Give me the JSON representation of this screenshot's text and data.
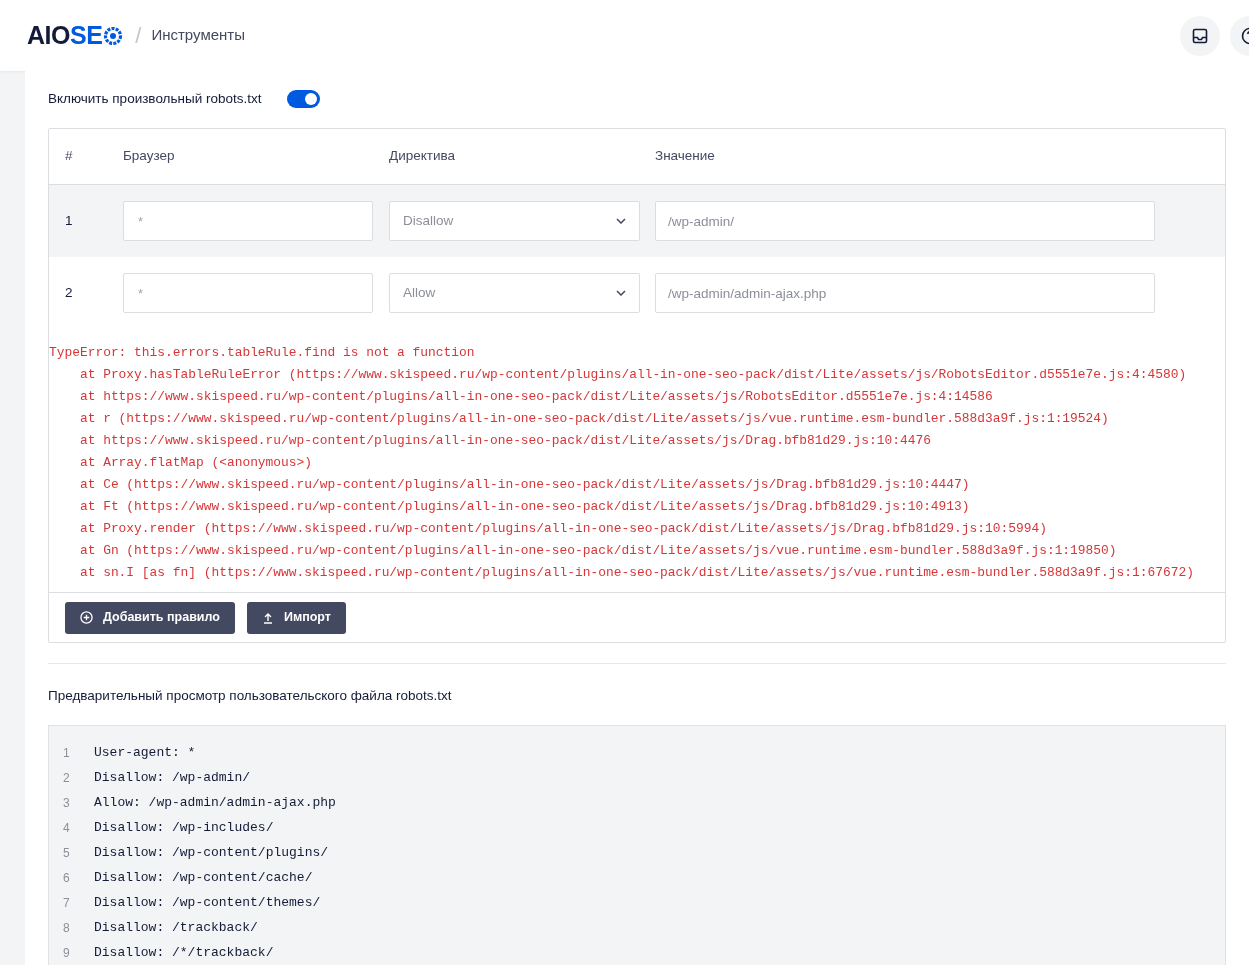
{
  "header": {
    "logo": {
      "dark": "AIO",
      "accent": "SE"
    },
    "separator": "/",
    "breadcrumb": "Инструменты"
  },
  "toggle": {
    "label": "Включить произвольный robots.txt",
    "on": true
  },
  "table": {
    "columns": [
      "#",
      "Браузер",
      "Директива",
      "Значение"
    ],
    "rows": [
      {
        "number": "1",
        "browser": "*",
        "directive": "Disallow",
        "value": "/wp-admin/",
        "highlighted": true
      },
      {
        "number": "2",
        "browser": "*",
        "directive": "Allow",
        "value": "/wp-admin/admin-ajax.php",
        "highlighted": false
      }
    ]
  },
  "error": [
    "TypeError: this.errors.tableRule.find is not a function",
    "    at Proxy.hasTableRuleError (https://www.skispeed.ru/wp-content/plugins/all-in-one-seo-pack/dist/Lite/assets/js/RobotsEditor.d5551e7e.js:4:4580)",
    "    at https://www.skispeed.ru/wp-content/plugins/all-in-one-seo-pack/dist/Lite/assets/js/RobotsEditor.d5551e7e.js:4:14586",
    "    at r (https://www.skispeed.ru/wp-content/plugins/all-in-one-seo-pack/dist/Lite/assets/js/vue.runtime.esm-bundler.588d3a9f.js:1:19524)",
    "    at https://www.skispeed.ru/wp-content/plugins/all-in-one-seo-pack/dist/Lite/assets/js/Drag.bfb81d29.js:10:4476",
    "    at Array.flatMap (<anonymous>)",
    "    at Ce (https://www.skispeed.ru/wp-content/plugins/all-in-one-seo-pack/dist/Lite/assets/js/Drag.bfb81d29.js:10:4447)",
    "    at Ft (https://www.skispeed.ru/wp-content/plugins/all-in-one-seo-pack/dist/Lite/assets/js/Drag.bfb81d29.js:10:4913)",
    "    at Proxy.render (https://www.skispeed.ru/wp-content/plugins/all-in-one-seo-pack/dist/Lite/assets/js/Drag.bfb81d29.js:10:5994)",
    "    at Gn (https://www.skispeed.ru/wp-content/plugins/all-in-one-seo-pack/dist/Lite/assets/js/vue.runtime.esm-bundler.588d3a9f.js:1:19850)",
    "    at sn.I [as fn] (https://www.skispeed.ru/wp-content/plugins/all-in-one-seo-pack/dist/Lite/assets/js/vue.runtime.esm-bundler.588d3a9f.js:1:67672)"
  ],
  "buttons": [
    {
      "kind": "add",
      "label": "Добавить правило"
    },
    {
      "kind": "import",
      "label": "Импорт"
    }
  ],
  "preview": {
    "title": "Предварительный просмотр пользовательского файла robots.txt",
    "lines": [
      {
        "number": "1",
        "text": "User-agent: *"
      },
      {
        "number": "2",
        "text": "Disallow: /wp-admin/"
      },
      {
        "number": "3",
        "text": "Allow: /wp-admin/admin-ajax.php"
      },
      {
        "number": "4",
        "text": "Disallow: /wp-includes/"
      },
      {
        "number": "5",
        "text": "Disallow: /wp-content/plugins/"
      },
      {
        "number": "6",
        "text": "Disallow: /wp-content/cache/"
      },
      {
        "number": "7",
        "text": "Disallow: /wp-content/themes/"
      },
      {
        "number": "8",
        "text": "Disallow: /trackback/"
      },
      {
        "number": "9",
        "text": "Disallow: /*/trackback/"
      }
    ]
  }
}
